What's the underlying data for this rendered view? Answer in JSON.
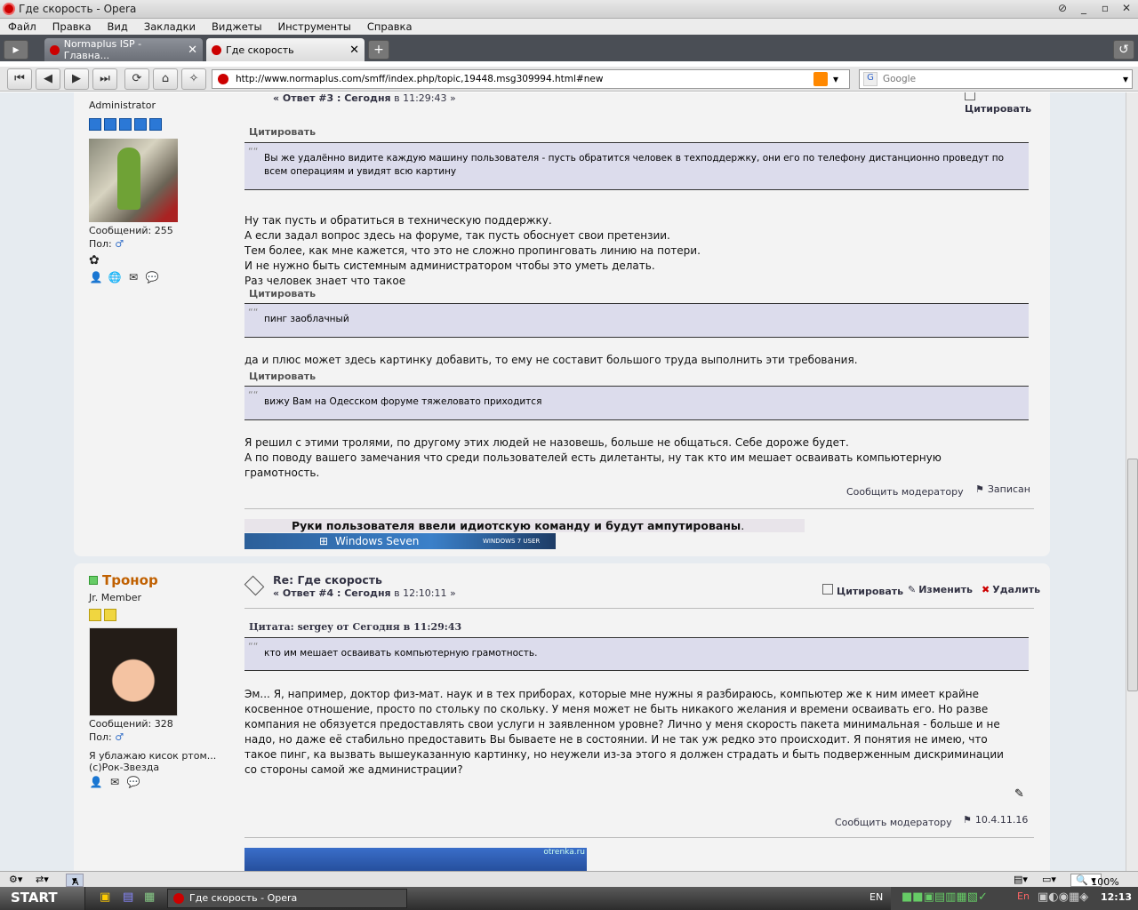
{
  "window": {
    "title": "Где скорость - Opera"
  },
  "menu": [
    "Файл",
    "Правка",
    "Вид",
    "Закладки",
    "Виджеты",
    "Инструменты",
    "Справка"
  ],
  "tabs": [
    {
      "label": "Normaplus ISP - Главна..."
    },
    {
      "label": "Где скорость"
    }
  ],
  "address": {
    "url": "http://www.normaplus.com/smff/index.php/topic,19448.msg309994.html#new",
    "search_placeholder": "Google"
  },
  "post1": {
    "rank": "Administrator",
    "messages": "Сообщений: 255",
    "gender": "Пол:",
    "header": {
      "reply": "« Ответ #3 : Сегодня",
      "time": " в 11:29:43 »",
      "quote_btn": "Цитировать"
    },
    "q1_hdr": "Цитировать",
    "q1": "Вы же удалённо видите каждую машину пользователя - пусть обратится человек в техподдержку, они его по телефону дистанционно проведут по всем операциям и увидят всю картину",
    "t1": [
      "Ну так пусть и обратиться в техническую поддержку.",
      "А если задал вопрос здесь на форуме, так пусть обоснует свои претензии.",
      "Тем более, как мне кажется, что это не сложно пропинговать линию на потери.",
      "И не нужно быть системным администратором чтобы это уметь делать.",
      "Раз человек знает что такое"
    ],
    "q2_hdr": "Цитировать",
    "q2": "пинг заоблачный",
    "t2": " да и плюс может здесь картинку добавить, то ему не составит большого труда выполнить эти требования.",
    "q3_hdr": "Цитировать",
    "q3": "вижу Вам на Одесском форуме тяжеловато приходится",
    "t3": [
      "Я решил с этими тролями, по другому этих людей не назовешь, больше не общаться. Себе дороже будет.",
      "А по поводу вашего замечания что среди пользователей есть дилетанты, ну так кто им мешает осваивать компьютерную",
      "грамотность."
    ],
    "report": "Сообщить модератору",
    "logged": "Записан",
    "sig": "Руки пользователя ввели идиотскую команду и будут ампутированы",
    "sig_period": ".",
    "badge_logo": "Windows Seven",
    "badge_tag": "WINDOWS 7 USER"
  },
  "post2": {
    "username": "Тронор",
    "rank": "Jr. Member",
    "messages": "Сообщений: 328",
    "gender": "Пол:",
    "personal": "Я ублажаю кисок ртом...",
    "personal2": "(с)Рок-Звезда",
    "title": "Re: Где скорость",
    "reply": "« Ответ #4 : Сегодня",
    "time": " в 12:10:11 »",
    "btn_quote": "Цитировать",
    "btn_edit": "Изменить",
    "btn_delete": "Удалить",
    "q_hdr": "Цитата: sergey от Сегодня в 11:29:43",
    "q": "кто им мешает осваивать компьютерную грамотность.",
    "text": [
      "Эм... Я, например, доктор физ-мат. наук и в тех приборах, которые мне нужны я разбираюсь, компьютер же к ним имеет крайне",
      "косвенное отношение, просто по стольку по скольку. У меня может не быть никакого желания и времени осваивать его. Но разве",
      "компания не обязуется предоставлять свои услуги н заявленном уровне? Лично у меня скорость пакета минимальная - больше и не",
      "надо, но даже её стабильно предоставить Вы бываете не в состоянии. И не так уж редко это происходит. Я понятия не имею, что",
      "такое пинг, ка вызвать вышеуказанную картинку, но неужели из-за этого я должен страдать и быть подверженным дискриминации",
      "со стороны самой же администрации?"
    ],
    "report": "Сообщить модератору",
    "ip": "10.4.11.16",
    "img_caption": "otrenka.ru"
  },
  "status": {
    "zoom": "100%",
    "pane_label": "A"
  },
  "taskbar": {
    "start": "START",
    "item": "Где скорость - Opera",
    "lang": "EN",
    "clock": "12:13"
  }
}
